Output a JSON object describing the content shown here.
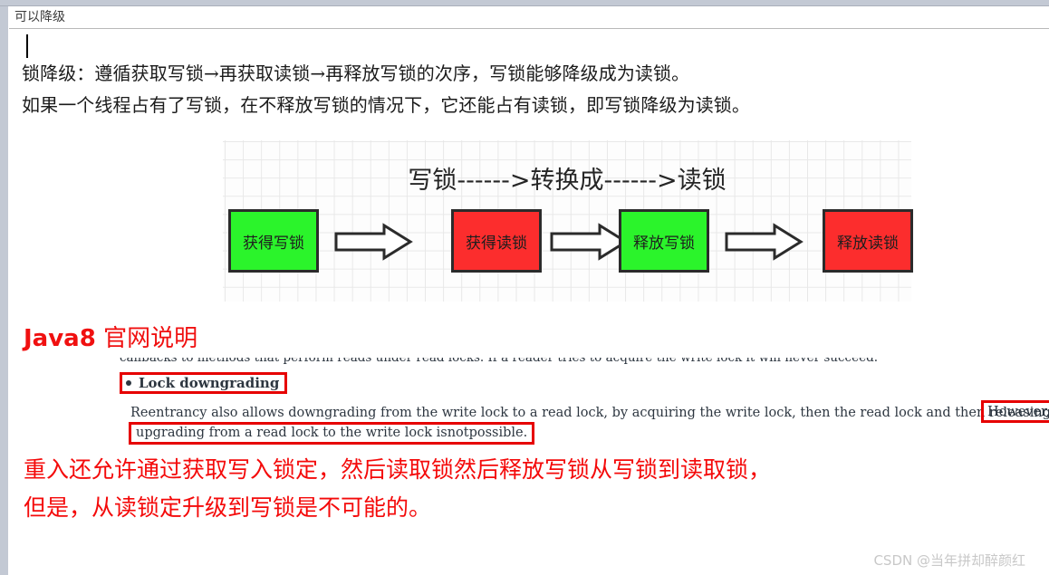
{
  "window": {
    "title": "可以降级"
  },
  "document": {
    "paragraphs": [
      "锁降级：遵循获取写锁→再获取读锁→再释放写锁的次序，写锁能够降级成为读锁。",
      "如果一个线程占有了写锁，在不释放写锁的情况下，它还能占有读锁，即写锁降级为读锁。"
    ]
  },
  "diagram": {
    "title": "写锁------>转换成------>读锁",
    "nodes": [
      {
        "label": "获得写锁",
        "color": "#2bf42b",
        "kind": "green"
      },
      {
        "label": "获得读锁",
        "color": "#fc2d2d",
        "kind": "red"
      },
      {
        "label": "释放写锁",
        "color": "#2bf42b",
        "kind": "green"
      },
      {
        "label": "释放读锁",
        "color": "#fc2d2d",
        "kind": "red"
      }
    ]
  },
  "java_section": {
    "heading_latin": "Java8",
    "heading_cjk": " 官网说明",
    "heading_color": "#f01010",
    "javadoc": {
      "clipped_line": "callbacks to methods that perform reads under read locks. If a reader tries to acquire the write lock it will never succeed.",
      "bullet_label": "Lock downgrading",
      "paragraph_line1": "Reentrancy also allows downgrading from the write lock to a read lock, by acquiring the write lock, then the read lock and then releasing the write lock.",
      "however_label": "However,",
      "paragraph_line2_pre": "upgrading from a read lock to the write lock is ",
      "paragraph_line2_bold": "not",
      "paragraph_line2_post": " possible.",
      "highlight_color": "#e60000"
    }
  },
  "translation": {
    "line1": "重入还允许通过获取写入锁定，然后读取锁然后释放写锁从写锁到读取锁，",
    "line2": "但是，从读锁定升级到写锁是不可能的。",
    "color": "#f40a0a"
  },
  "watermark": {
    "text": "CSDN @当年拼却醉颜红"
  }
}
